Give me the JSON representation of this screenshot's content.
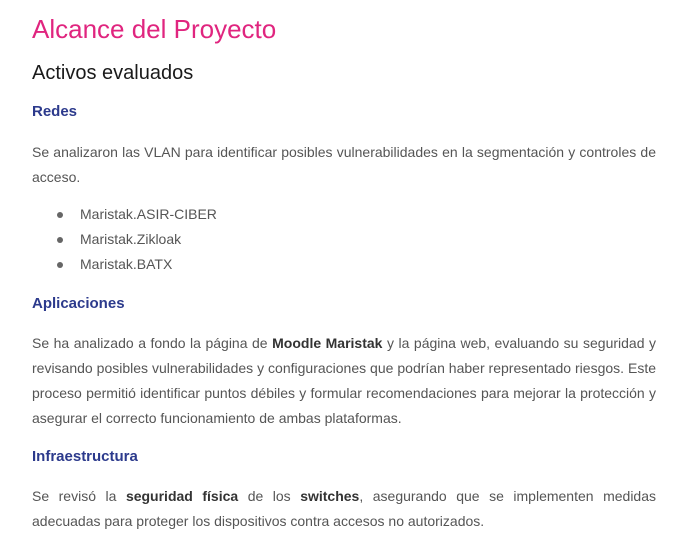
{
  "title": "Alcance del Proyecto",
  "subtitle": "Activos evaluados",
  "redes": {
    "heading": "Redes",
    "paragraph": "Se analizaron las VLAN para identificar posibles vulnerabilidades en la segmentación y controles de acceso.",
    "items": [
      "Maristak.ASIR-CIBER",
      "Maristak.Zikloak",
      "Maristak.BATX"
    ]
  },
  "aplicaciones": {
    "heading": "Aplicaciones",
    "p_part1": "Se ha analizado a fondo la página de ",
    "p_bold1": "Moodle Maristak",
    "p_part2": " y la página web, evaluando su seguridad y revisando posibles vulnerabilidades y configuraciones que podrían haber representado riesgos. Este proceso permitió identificar puntos débiles y formular recomendaciones para mejorar la protección y asegurar el correcto funcionamiento de ambas plataformas."
  },
  "infraestructura": {
    "heading": "Infraestructura",
    "p_part1": "Se revisó la ",
    "p_bold1": "seguridad física",
    "p_part2": " de los ",
    "p_bold2": "switches",
    "p_part3": ", asegurando que se implementen medidas adecuadas para proteger los dispositivos contra accesos no autorizados."
  },
  "colors": {
    "title": "#e0257f",
    "heading": "#2c3a8c",
    "body_text": "#555555"
  }
}
